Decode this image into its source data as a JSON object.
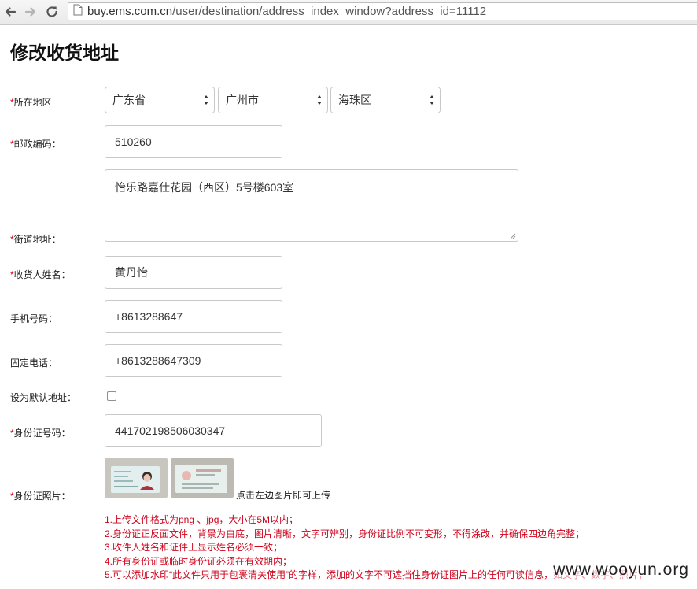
{
  "browser": {
    "url_host": "buy.ems.com.cn",
    "url_path": "/user/destination/address_index_window?address_id=11112"
  },
  "page": {
    "title": "修改收货地址"
  },
  "form": {
    "required_mark": "*",
    "region": {
      "label": "所在地区",
      "province": "广东省",
      "city": "广州市",
      "district": "海珠区"
    },
    "postcode": {
      "label": "邮政编码：",
      "value": "510260"
    },
    "street": {
      "label": "街道地址：",
      "value": "怡乐路嘉仕花园（西区）5号楼603室"
    },
    "receiver": {
      "label": "收货人姓名：",
      "value": "黄丹怡"
    },
    "mobile": {
      "label": "手机号码：",
      "value": "+8613288647"
    },
    "phone": {
      "label": "固定电话：",
      "value": "+8613288647309"
    },
    "default": {
      "label": "设为默认地址：",
      "checked": false
    },
    "id_number": {
      "label": "身份证号码：",
      "value": "441702198506030347"
    },
    "id_photo": {
      "label": "身份证照片：",
      "upload_hint": "点击左边图片即可上传"
    },
    "notes": [
      "1.上传文件格式为png 、jpg，大小在5M以内；",
      "2.身份证正反面文件，背景为白底，图片清晰，文字可辨别，身份证比例不可变形，不得涂改，并确保四边角完整；",
      "3.收件人姓名和证件上显示姓名必须一致；",
      "4.所有身份证或临时身份证必须在有效期内；",
      "5.可以添加水印“此文件只用于包裹清关使用”的字样，添加的文字不可遮挡住身份证图片上的任何可读信息，如文字、数字、照片；"
    ]
  },
  "watermark": "www.wooyun.org",
  "colors": {
    "required": "#d0021b",
    "notes": "#d0021b",
    "border": "#c9c9c9"
  }
}
